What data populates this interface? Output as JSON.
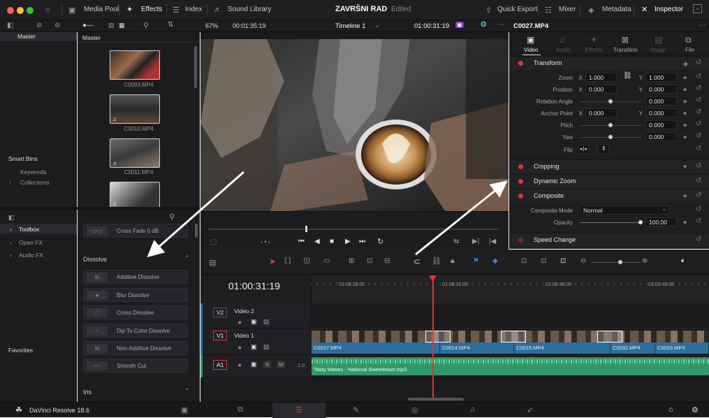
{
  "topbar": {
    "media_pool": "Media Pool",
    "effects": "Effects",
    "index": "Index",
    "sound_library": "Sound Library",
    "project_title": "ZAVRŠNI RAD",
    "edited": "Edited",
    "quick_export": "Quick Export",
    "mixer": "Mixer",
    "metadata": "Metadata",
    "inspector": "Inspector"
  },
  "viewer_bar": {
    "zoom": "67%",
    "timecode": "00:01:35:19",
    "timeline_name": "Timeline 1",
    "playhead_tc": "01:00:31:19",
    "clip_name": "C0027.MP4"
  },
  "media_pool": {
    "master": "Master",
    "master_bin_header": "Master",
    "smart_bins": "Smart Bins",
    "keywords": "Keywords",
    "collections": "Collections",
    "clips": [
      {
        "name": "C0003.MP4"
      },
      {
        "name": "C0010.MP4"
      },
      {
        "name": "C0011.MP4"
      },
      {
        "name": ""
      }
    ]
  },
  "effects_panel": {
    "toolbox": "Toolbox",
    "open_fx": "Open FX",
    "audio_fx": "Audio FX",
    "favorites": "Favorites",
    "cross_fade": "Cross Fade 0 dB",
    "dissolve_header": "Dissolve",
    "iris_header": "Iris",
    "transitions": [
      "Additive Dissolve",
      "Blur Dissolve",
      "Cross Dissolve",
      "Dip To Color Dissolve",
      "Non-Additive Dissolve",
      "Smooth Cut"
    ]
  },
  "inspector": {
    "tabs": [
      "Video",
      "Audio",
      "Effects",
      "Transition",
      "Image",
      "File"
    ],
    "transform": "Transform",
    "zoom_label": "Zoom",
    "zoom_x": "1.000",
    "zoom_y": "1.000",
    "position_label": "Position",
    "position_x": "0.000",
    "position_y": "0.000",
    "rotation_label": "Rotation Angle",
    "rotation_val": "0.000",
    "anchor_label": "Anchor Point",
    "anchor_x": "0.000",
    "anchor_y": "0.000",
    "pitch_label": "Pitch",
    "pitch_val": "0.000",
    "yaw_label": "Yaw",
    "yaw_val": "0.000",
    "flip_label": "Flip",
    "cropping": "Cropping",
    "dynamic_zoom": "Dynamic Zoom",
    "composite": "Composite",
    "composite_mode_label": "Composite Mode",
    "composite_mode": "Normal",
    "opacity_label": "Opacity",
    "opacity_val": "100.00",
    "speed_change": "Speed Change"
  },
  "timeline": {
    "timecode": "01:00:31:19",
    "ruler": [
      "01:00:28:00",
      "01:00:32:00",
      "01:00:36:00",
      "01:00:40:00"
    ],
    "v2_tag": "V2",
    "v2_name": "Video 2",
    "v1_tag": "V1",
    "v1_name": "Video 1",
    "a1_tag": "A1",
    "a1_level": "2.0",
    "video_clips": [
      "C0027.MP4",
      "C0014.MP4",
      "C0015.MP4",
      "C0032.MP4",
      "C0033.MP4"
    ],
    "audio_clip": "Tasty Waves - National Sweetheart.mp3"
  },
  "bottom": {
    "app_name": "DaVinci Resolve 18.6"
  },
  "colors": {
    "accent_red": "#e23636",
    "clip_blue": "#2d6f9c",
    "audio_green": "#2f9a67",
    "playhead": "#e3342f"
  }
}
